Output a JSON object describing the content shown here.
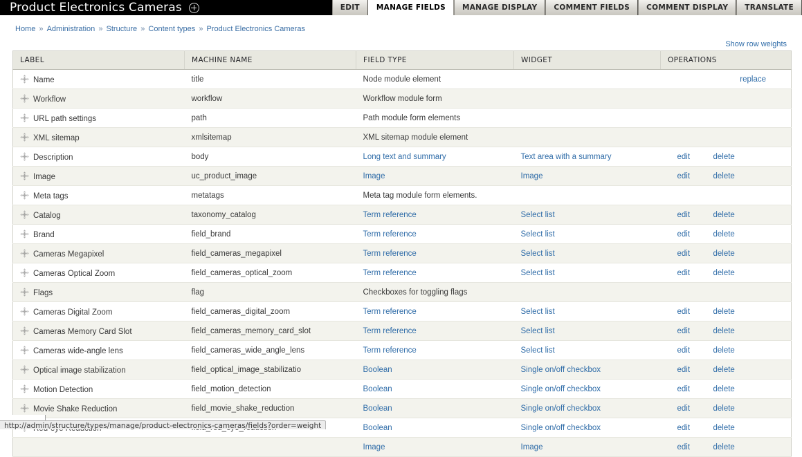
{
  "titlebar": {
    "title": "Product Electronics Cameras",
    "add_icon": "circle-plus-icon"
  },
  "tabs": [
    {
      "label": "EDIT",
      "active": false
    },
    {
      "label": "MANAGE FIELDS",
      "active": true
    },
    {
      "label": "MANAGE DISPLAY",
      "active": false
    },
    {
      "label": "COMMENT FIELDS",
      "active": false
    },
    {
      "label": "COMMENT DISPLAY",
      "active": false
    },
    {
      "label": "TRANSLATE",
      "active": false
    }
  ],
  "breadcrumb": {
    "separator": "»",
    "items": [
      "Home",
      "Administration",
      "Structure",
      "Content types",
      "Product Electronics Cameras"
    ]
  },
  "show_row_weights": "Show row weights",
  "table": {
    "columns": [
      "LABEL",
      "MACHINE NAME",
      "FIELD TYPE",
      "WIDGET",
      "OPERATIONS"
    ],
    "rows": [
      {
        "label": "Name",
        "machine_name": "title",
        "field_type": "Node module element",
        "field_type_link": false,
        "widget": "",
        "widget_link": false,
        "ops": [
          {
            "label": "replace",
            "kind": "replace"
          }
        ]
      },
      {
        "label": "Workflow",
        "machine_name": "workflow",
        "field_type": "Workflow module form",
        "field_type_link": false,
        "widget": "",
        "widget_link": false,
        "ops": []
      },
      {
        "label": "URL path settings",
        "machine_name": "path",
        "field_type": "Path module form elements",
        "field_type_link": false,
        "widget": "",
        "widget_link": false,
        "ops": []
      },
      {
        "label": "XML sitemap",
        "machine_name": "xmlsitemap",
        "field_type": "XML sitemap module element",
        "field_type_link": false,
        "widget": "",
        "widget_link": false,
        "ops": []
      },
      {
        "label": "Description",
        "machine_name": "body",
        "field_type": "Long text and summary",
        "field_type_link": true,
        "widget": "Text area with a summary",
        "widget_link": true,
        "ops": [
          {
            "label": "edit",
            "kind": "edit"
          },
          {
            "label": "delete",
            "kind": "delete"
          }
        ]
      },
      {
        "label": "Image",
        "machine_name": "uc_product_image",
        "field_type": "Image",
        "field_type_link": true,
        "widget": "Image",
        "widget_link": true,
        "ops": [
          {
            "label": "edit",
            "kind": "edit"
          },
          {
            "label": "delete",
            "kind": "delete"
          }
        ]
      },
      {
        "label": "Meta tags",
        "machine_name": "metatags",
        "field_type": "Meta tag module form elements.",
        "field_type_link": false,
        "widget": "",
        "widget_link": false,
        "ops": []
      },
      {
        "label": "Catalog",
        "machine_name": "taxonomy_catalog",
        "field_type": "Term reference",
        "field_type_link": true,
        "widget": "Select list",
        "widget_link": true,
        "ops": [
          {
            "label": "edit",
            "kind": "edit"
          },
          {
            "label": "delete",
            "kind": "delete"
          }
        ]
      },
      {
        "label": "Brand",
        "machine_name": "field_brand",
        "field_type": "Term reference",
        "field_type_link": true,
        "widget": "Select list",
        "widget_link": true,
        "ops": [
          {
            "label": "edit",
            "kind": "edit"
          },
          {
            "label": "delete",
            "kind": "delete"
          }
        ]
      },
      {
        "label": "Cameras Megapixel",
        "machine_name": "field_cameras_megapixel",
        "field_type": "Term reference",
        "field_type_link": true,
        "widget": "Select list",
        "widget_link": true,
        "ops": [
          {
            "label": "edit",
            "kind": "edit"
          },
          {
            "label": "delete",
            "kind": "delete"
          }
        ]
      },
      {
        "label": "Cameras Optical Zoom",
        "machine_name": "field_cameras_optical_zoom",
        "field_type": "Term reference",
        "field_type_link": true,
        "widget": "Select list",
        "widget_link": true,
        "ops": [
          {
            "label": "edit",
            "kind": "edit"
          },
          {
            "label": "delete",
            "kind": "delete"
          }
        ]
      },
      {
        "label": "Flags",
        "machine_name": "flag",
        "field_type": "Checkboxes for toggling flags",
        "field_type_link": false,
        "widget": "",
        "widget_link": false,
        "ops": []
      },
      {
        "label": "Cameras Digital Zoom",
        "machine_name": "field_cameras_digital_zoom",
        "field_type": "Term reference",
        "field_type_link": true,
        "widget": "Select list",
        "widget_link": true,
        "ops": [
          {
            "label": "edit",
            "kind": "edit"
          },
          {
            "label": "delete",
            "kind": "delete"
          }
        ]
      },
      {
        "label": "Cameras Memory Card Slot",
        "machine_name": "field_cameras_memory_card_slot",
        "field_type": "Term reference",
        "field_type_link": true,
        "widget": "Select list",
        "widget_link": true,
        "ops": [
          {
            "label": "edit",
            "kind": "edit"
          },
          {
            "label": "delete",
            "kind": "delete"
          }
        ]
      },
      {
        "label": "Cameras wide-angle lens",
        "machine_name": "field_cameras_wide_angle_lens",
        "field_type": "Term reference",
        "field_type_link": true,
        "widget": "Select list",
        "widget_link": true,
        "ops": [
          {
            "label": "edit",
            "kind": "edit"
          },
          {
            "label": "delete",
            "kind": "delete"
          }
        ]
      },
      {
        "label": "Optical image stabilization",
        "machine_name": "field_optical_image_stabilizatio",
        "field_type": "Boolean",
        "field_type_link": true,
        "widget": "Single on/off checkbox",
        "widget_link": true,
        "ops": [
          {
            "label": "edit",
            "kind": "edit"
          },
          {
            "label": "delete",
            "kind": "delete"
          }
        ]
      },
      {
        "label": "Motion Detection",
        "machine_name": "field_motion_detection",
        "field_type": "Boolean",
        "field_type_link": true,
        "widget": "Single on/off checkbox",
        "widget_link": true,
        "ops": [
          {
            "label": "edit",
            "kind": "edit"
          },
          {
            "label": "delete",
            "kind": "delete"
          }
        ]
      },
      {
        "label": "Movie Shake Reduction",
        "machine_name": "field_movie_shake_reduction",
        "field_type": "Boolean",
        "field_type_link": true,
        "widget": "Single on/off checkbox",
        "widget_link": true,
        "ops": [
          {
            "label": "edit",
            "kind": "edit"
          },
          {
            "label": "delete",
            "kind": "delete"
          }
        ]
      },
      {
        "label": "Red-eye Reduction",
        "machine_name": "field_red_eye_reduction",
        "field_type": "Boolean",
        "field_type_link": true,
        "widget": "Single on/off checkbox",
        "widget_link": true,
        "ops": [
          {
            "label": "edit",
            "kind": "edit"
          },
          {
            "label": "delete",
            "kind": "delete"
          }
        ]
      },
      {
        "label": "",
        "machine_name": "",
        "field_type": "Image",
        "field_type_link": true,
        "widget": "Image",
        "widget_link": true,
        "ops": [
          {
            "label": "edit",
            "kind": "edit"
          },
          {
            "label": "delete",
            "kind": "delete"
          }
        ]
      }
    ]
  },
  "statusbar": {
    "url": "http://admin/structure/types/manage/product-electronics-cameras/fields?order=weight"
  },
  "colors": {
    "link": "#2f6ca8",
    "titlebar_bg": "#000000",
    "header_bg": "#e8e8e0",
    "row_alt_bg": "#f3f3ed"
  }
}
